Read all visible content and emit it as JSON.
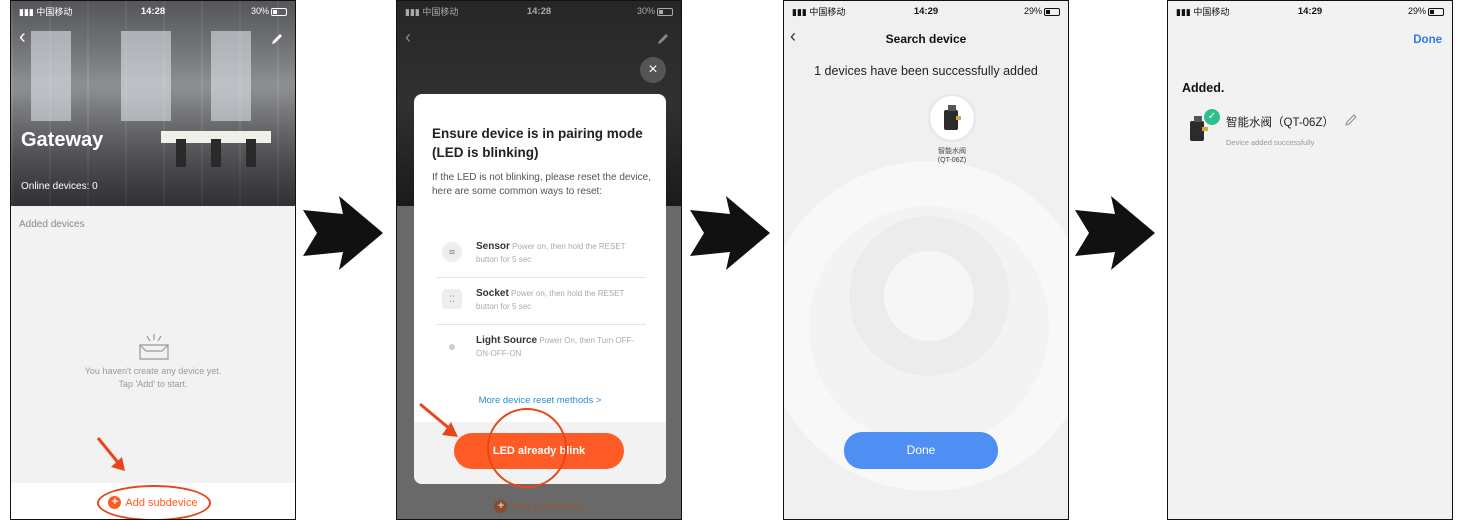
{
  "status_bars": [
    {
      "carrier": "中国移动",
      "time": "14:28",
      "battery": "30%"
    },
    {
      "carrier": "中国移动",
      "time": "14:28",
      "battery": "30%"
    },
    {
      "carrier": "中国移动",
      "time": "14:29",
      "battery": "29%"
    },
    {
      "carrier": "中国移动",
      "time": "14:29",
      "battery": "29%"
    }
  ],
  "screen1": {
    "title": "Gateway",
    "online_devices": "Online devices: 0",
    "added_devices_label": "Added devices",
    "empty_line1": "You haven't create any device yet.",
    "empty_line2": "Tap 'Add' to start.",
    "add_subdevice": "Add subdevice"
  },
  "screen2": {
    "modal_title": "Ensure device is in pairing mode (LED is blinking)",
    "modal_desc": "If the LED is not blinking, please reset the device, here are some common ways to reset:",
    "items": [
      {
        "name": "Sensor",
        "text": "Power on, then hold the RESET button for 5 sec"
      },
      {
        "name": "Socket",
        "text": "Power on, then hold the RESET button for 5 sec"
      },
      {
        "name": "Light Source",
        "text": "Power On, then Turn OFF-ON-OFF-ON"
      }
    ],
    "more_link": "More device reset methods >",
    "led_button": "LED already blink",
    "add_subdevice": "Add subdevice"
  },
  "screen3": {
    "title": "Search device",
    "count_text": "1 devices have been successfully added",
    "device_name": "智能水阀",
    "device_model": "(QT-06Z)",
    "done_button": "Done"
  },
  "screen4": {
    "done": "Done",
    "added_title": "Added.",
    "device_name": "智能水阀（QT-06Z）",
    "device_status": "Device added successfully"
  },
  "colors": {
    "accent_orange": "#ff5b27",
    "annotation_red": "#e8451b",
    "primary_blue": "#4f8ef3",
    "link_blue": "#2e7be6",
    "success_green": "#2fbf8f"
  }
}
